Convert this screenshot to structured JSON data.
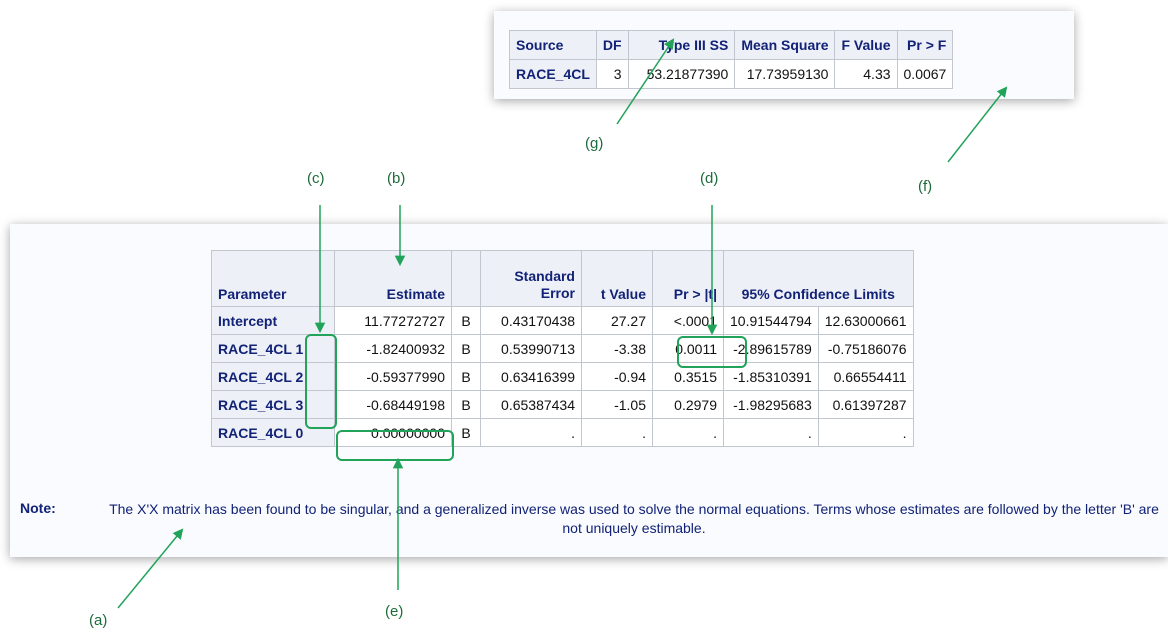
{
  "anova": {
    "headers": [
      "Source",
      "DF",
      "Type III SS",
      "Mean Square",
      "F Value",
      "Pr > F"
    ],
    "row": [
      "RACE_4CL",
      "3",
      "53.21877390",
      "17.73959130",
      "4.33",
      "0.0067"
    ]
  },
  "parameters": {
    "headers": {
      "parameter": "Parameter",
      "estimate": "Estimate",
      "stderr": "Standard Error",
      "tvalue": "t Value",
      "p": "Pr > |t|",
      "ci": "95% Confidence Limits"
    },
    "rows": [
      [
        "Intercept",
        "11.77272727",
        "B",
        "0.43170438",
        "27.27",
        "<.0001",
        "10.91544794",
        "12.63000661"
      ],
      [
        "RACE_4CL 1",
        "-1.82400932",
        "B",
        "0.53990713",
        "-3.38",
        "0.0011",
        "-2.89615789",
        "-0.75186076"
      ],
      [
        "RACE_4CL 2",
        "-0.59377990",
        "B",
        "0.63416399",
        "-0.94",
        "0.3515",
        "-1.85310391",
        "0.66554411"
      ],
      [
        "RACE_4CL 3",
        "-0.68449198",
        "B",
        "0.65387434",
        "-1.05",
        "0.2979",
        "-1.98295683",
        "0.61397287"
      ],
      [
        "RACE_4CL 0",
        "0.00000000",
        "B",
        ".",
        ".",
        ".",
        ".",
        "."
      ]
    ]
  },
  "note": {
    "label": "Note:",
    "text": "The X'X matrix has been found to be singular, and a generalized inverse was used to solve the normal equations. Terms whose estimates are followed by the letter 'B' are not uniquely estimable."
  },
  "callouts": {
    "a": "(a)",
    "b": "(b)",
    "c": "(c)",
    "d": "(d)",
    "e": "(e)",
    "f": "(f)",
    "g": "(g)"
  },
  "colors": {
    "header_text": "#112277",
    "header_bg": "#eef0f7",
    "annotation": "#21a35a"
  }
}
